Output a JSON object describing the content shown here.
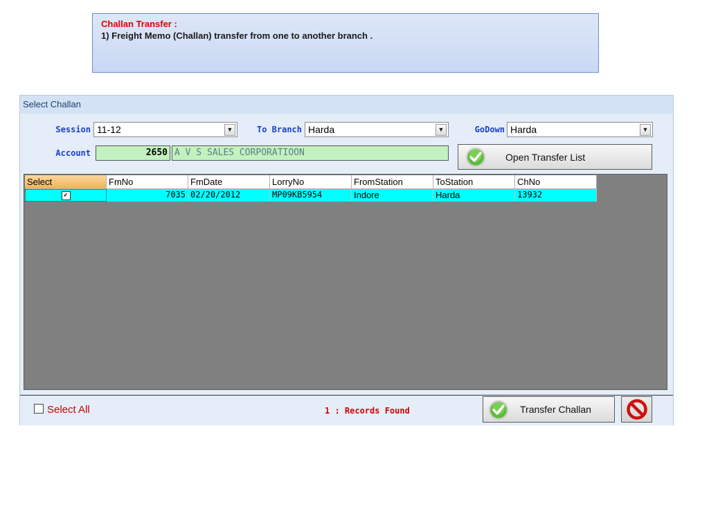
{
  "note": {
    "title": "Challan Transfer :",
    "line1": "1)  Freight Memo (Challan) transfer from one  to another branch ."
  },
  "panel": {
    "title": "Select Challan"
  },
  "form": {
    "session_label": "Session",
    "session_value": "11-12",
    "to_branch_label": "To Branch",
    "to_branch_value": "Harda",
    "godown_label": "GoDown",
    "godown_value": "Harda",
    "account_label": "Account",
    "account_code": "2650",
    "account_name": "A V S SALES CORPORATIOON",
    "open_transfer_label": "Open Transfer List"
  },
  "grid": {
    "columns": [
      "Select",
      "FmNo",
      "FmDate",
      "LorryNo",
      "FromStation",
      "ToStation",
      "ChNo"
    ],
    "rows": [
      {
        "select": "✔",
        "fmno": "7035",
        "fmdate": "02/20/2012",
        "lorryno": "MP09KB5954",
        "fromstation": "Indore",
        "tostation": "Harda",
        "chno": "13932"
      }
    ]
  },
  "footer": {
    "select_all_label": "Select All",
    "records_text": "1 : Records Found",
    "transfer_label": "Transfer Challan"
  },
  "icons": {
    "ok": "check-circle-icon",
    "cancel": "no-entry-icon"
  },
  "colors": {
    "row_highlight": "#00ffff",
    "account_field": "#c2f2bf",
    "label_blue": "#1a3fd0",
    "alert_red": "#d00000"
  }
}
